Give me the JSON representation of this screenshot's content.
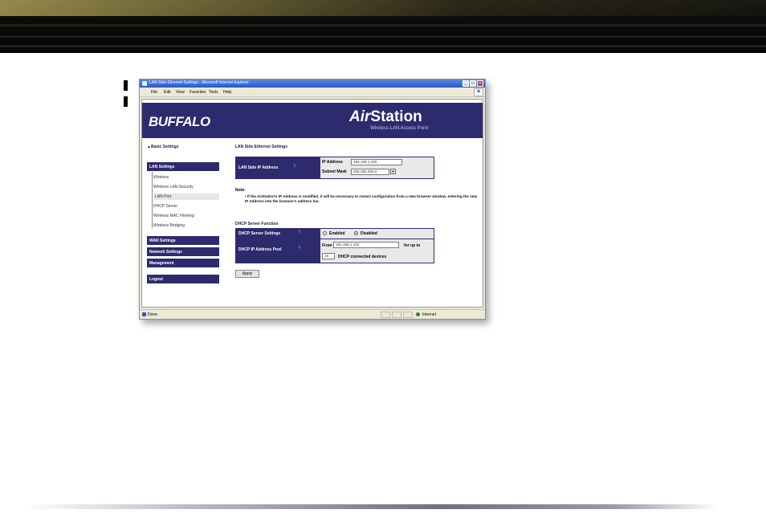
{
  "browser": {
    "title": "LAN Side Ethernet Settings - Microsoft Internet Explorer",
    "menu": [
      "File",
      "Edit",
      "View",
      "Favorites",
      "Tools",
      "Help"
    ],
    "status": "Done",
    "zone": "Internet"
  },
  "header": {
    "logo": "BUFFALO",
    "product_air": "Air",
    "product_station": "Station",
    "subtitle": "Wireless LAN Access Point"
  },
  "sidebar": {
    "basic": "Basic Settings",
    "lan_settings": "LAN Settings",
    "lan_items": [
      "Wireless",
      "Wireless LAN Security",
      "LAN Port",
      "DHCP Server",
      "Wireless MAC Filtering",
      "Wireless Bridging"
    ],
    "active_index": 2,
    "wan_settings": "WAN Settings",
    "network_settings": "Network Settings",
    "management": "Management",
    "logout": "Logout"
  },
  "main": {
    "title": "LAN Side Ethernet Settings",
    "lan_ip_label": "LAN Side IP Address",
    "ip_label": "IP Address",
    "ip_value": "192.168.1.100",
    "mask_label": "Subnet Mask",
    "mask_value": "255.255.255.0",
    "note_title": "Note:",
    "note_text": "If the AirStation's IP Address is modified, it will be necessary to restart configuration from a new browser window, entering the new IP Address into the browser's address bar.",
    "dhcp_title": "DHCP Server Function",
    "dhcp_server_label": "DHCP Server Settings",
    "enabled_label": "Enabled",
    "disabled_label": "Disabled",
    "dhcp_pool_label": "DHCP IP Address Pool",
    "from_label": "From",
    "from_value": "192.168.1.102",
    "for_up_to": "for up to",
    "count_value": "16",
    "devices_label": "DHCP connected devices",
    "apply": "Apply"
  }
}
